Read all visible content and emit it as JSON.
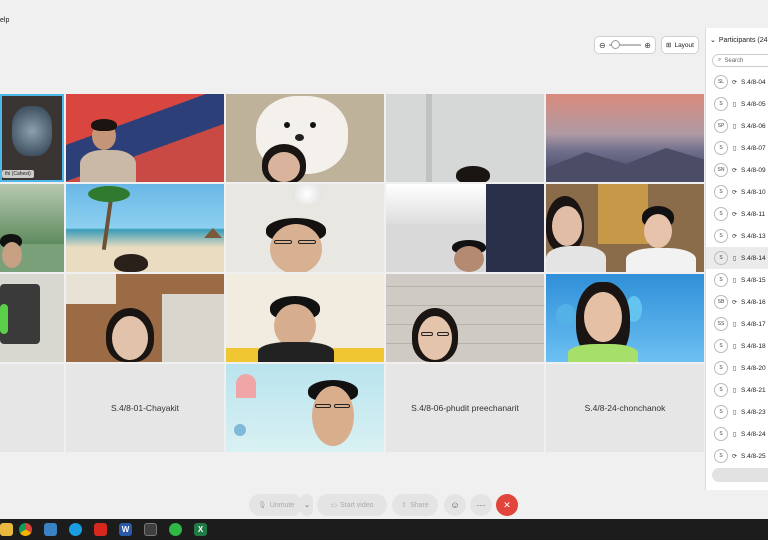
{
  "menu": {
    "help_fragment": "elp"
  },
  "toolbar_top": {
    "layout_label": "Layout",
    "zoom_icon": "zoom-icons"
  },
  "grid": {
    "tiles": [
      {
        "name_label": "thi (Cahest)"
      }
    ],
    "name_cards": [
      {
        "label": "S.4/8-01-Chayakit"
      },
      {
        "label": "S.4/8-06-phudit preechanarit"
      },
      {
        "label": "S.4/8-24-chonchanok"
      }
    ]
  },
  "participants": {
    "title": "Participants (24",
    "search_placeholder": "Search",
    "items": [
      {
        "initials": "SL",
        "name": "S.4/8-04",
        "device": "desktop"
      },
      {
        "initials": "S",
        "name": "S.4/8-05",
        "device": "mobile"
      },
      {
        "initials": "SP",
        "name": "S.4/8-06",
        "device": "mobile"
      },
      {
        "initials": "S",
        "name": "S.4/8-07",
        "device": "mobile"
      },
      {
        "initials": "SN",
        "name": "S.4/8-09",
        "device": "desktop"
      },
      {
        "initials": "S",
        "name": "S.4/8-10",
        "device": "desktop"
      },
      {
        "initials": "S",
        "name": "S.4/8-11",
        "device": "desktop"
      },
      {
        "initials": "S",
        "name": "S.4/8-13",
        "device": "desktop"
      },
      {
        "initials": "S",
        "name": "S.4/8-14",
        "device": "mobile",
        "selected": true
      },
      {
        "initials": "S",
        "name": "S.4/8-15",
        "device": "mobile"
      },
      {
        "initials": "SB",
        "name": "S.4/8-16",
        "device": "desktop"
      },
      {
        "initials": "SS",
        "name": "S.4/8-17",
        "device": "mobile"
      },
      {
        "initials": "S",
        "name": "S.4/8-18",
        "device": "mobile"
      },
      {
        "initials": "S",
        "name": "S.4/8-20",
        "device": "mobile"
      },
      {
        "initials": "S",
        "name": "S.4/8-21",
        "device": "mobile"
      },
      {
        "initials": "S",
        "name": "S.4/8-23",
        "device": "mobile"
      },
      {
        "initials": "S",
        "name": "S.4/8-24",
        "device": "mobile"
      },
      {
        "initials": "S",
        "name": "S.4/8-25",
        "device": "desktop"
      }
    ]
  },
  "controls": {
    "unmute": "Unmute",
    "start_video": "Start video",
    "share": "Share",
    "more": "···",
    "end": "✕",
    "end_color": "#e0443a"
  },
  "taskbar": {
    "icons": [
      "file-explorer",
      "chrome",
      "store",
      "edge",
      "acrobat",
      "word",
      "webex",
      "line",
      "excel"
    ]
  }
}
